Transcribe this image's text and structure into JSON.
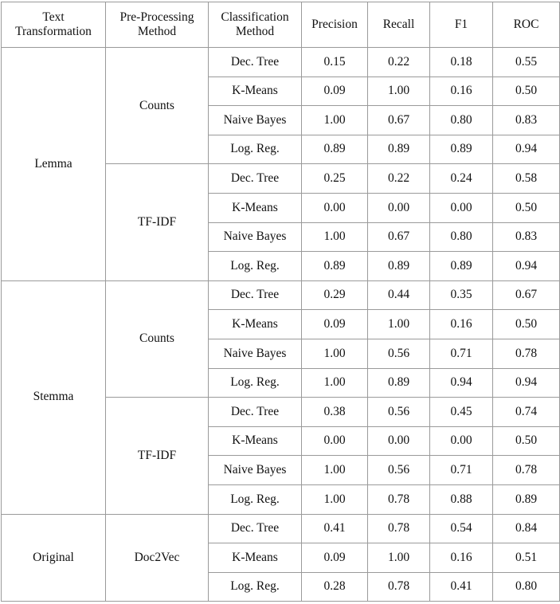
{
  "table": {
    "columns": [
      {
        "key": "transformation",
        "label": "Text Transformation"
      },
      {
        "key": "preprocessing",
        "label": "Pre-Processing Method"
      },
      {
        "key": "classification",
        "label": "Classification Method"
      },
      {
        "key": "precision",
        "label": "Precision"
      },
      {
        "key": "recall",
        "label": "Recall"
      },
      {
        "key": "f1",
        "label": "F1"
      },
      {
        "key": "roc",
        "label": "ROC"
      }
    ],
    "groups": [
      {
        "transformation": "Lemma",
        "transformation_bold": false,
        "subgroups": [
          {
            "preprocessing": "Counts",
            "preprocessing_bold": false,
            "rows": [
              {
                "classification": "Dec. Tree",
                "precision": "0.15",
                "recall": "0.22",
                "f1": "0.18",
                "roc": "0.55",
                "bold": false
              },
              {
                "classification": "K-Means",
                "precision": "0.09",
                "recall": "1.00",
                "f1": "0.16",
                "roc": "0.50",
                "bold": false
              },
              {
                "classification": "Naive Bayes",
                "precision": "1.00",
                "recall": "0.67",
                "f1": "0.80",
                "roc": "0.83",
                "bold": false
              },
              {
                "classification": "Log. Reg.",
                "precision": "0.89",
                "recall": "0.89",
                "f1": "0.89",
                "roc": "0.94",
                "bold": false
              }
            ]
          },
          {
            "preprocessing": "TF-IDF",
            "preprocessing_bold": false,
            "rows": [
              {
                "classification": "Dec. Tree",
                "precision": "0.25",
                "recall": "0.22",
                "f1": "0.24",
                "roc": "0.58",
                "bold": false
              },
              {
                "classification": "K-Means",
                "precision": "0.00",
                "recall": "0.00",
                "f1": "0.00",
                "roc": "0.50",
                "bold": false
              },
              {
                "classification": "Naive Bayes",
                "precision": "1.00",
                "recall": "0.67",
                "f1": "0.80",
                "roc": "0.83",
                "bold": false
              },
              {
                "classification": "Log. Reg.",
                "precision": "0.89",
                "recall": "0.89",
                "f1": "0.89",
                "roc": "0.94",
                "bold": false
              }
            ]
          }
        ]
      },
      {
        "transformation": "Stemma",
        "transformation_bold": true,
        "subgroups": [
          {
            "preprocessing": "Counts",
            "preprocessing_bold": true,
            "rows": [
              {
                "classification": "Dec. Tree",
                "precision": "0.29",
                "recall": "0.44",
                "f1": "0.35",
                "roc": "0.67",
                "bold": false
              },
              {
                "classification": "K-Means",
                "precision": "0.09",
                "recall": "1.00",
                "f1": "0.16",
                "roc": "0.50",
                "bold": false
              },
              {
                "classification": "Naive Bayes",
                "precision": "1.00",
                "recall": "0.56",
                "f1": "0.71",
                "roc": "0.78",
                "bold": false
              },
              {
                "classification": "Log. Reg.",
                "precision": "1.00",
                "recall": "0.89",
                "f1": "0.94",
                "roc": "0.94",
                "bold": true
              }
            ]
          },
          {
            "preprocessing": "TF-IDF",
            "preprocessing_bold": false,
            "rows": [
              {
                "classification": "Dec. Tree",
                "precision": "0.38",
                "recall": "0.56",
                "f1": "0.45",
                "roc": "0.74",
                "bold": false
              },
              {
                "classification": "K-Means",
                "precision": "0.00",
                "recall": "0.00",
                "f1": "0.00",
                "roc": "0.50",
                "bold": false
              },
              {
                "classification": "Naive Bayes",
                "precision": "1.00",
                "recall": "0.56",
                "f1": "0.71",
                "roc": "0.78",
                "bold": false
              },
              {
                "classification": "Log. Reg.",
                "precision": "1.00",
                "recall": "0.78",
                "f1": "0.88",
                "roc": "0.89",
                "bold": false
              }
            ]
          }
        ]
      },
      {
        "transformation": "Original",
        "transformation_bold": false,
        "subgroups": [
          {
            "preprocessing": "Doc2Vec",
            "preprocessing_bold": false,
            "rows": [
              {
                "classification": "Dec. Tree",
                "precision": "0.41",
                "recall": "0.78",
                "f1": "0.54",
                "roc": "0.84",
                "bold": false
              },
              {
                "classification": "K-Means",
                "precision": "0.09",
                "recall": "1.00",
                "f1": "0.16",
                "roc": "0.51",
                "bold": false
              },
              {
                "classification": "Log. Reg.",
                "precision": "0.28",
                "recall": "0.78",
                "f1": "0.41",
                "roc": "0.80",
                "bold": false
              }
            ]
          }
        ]
      }
    ]
  }
}
